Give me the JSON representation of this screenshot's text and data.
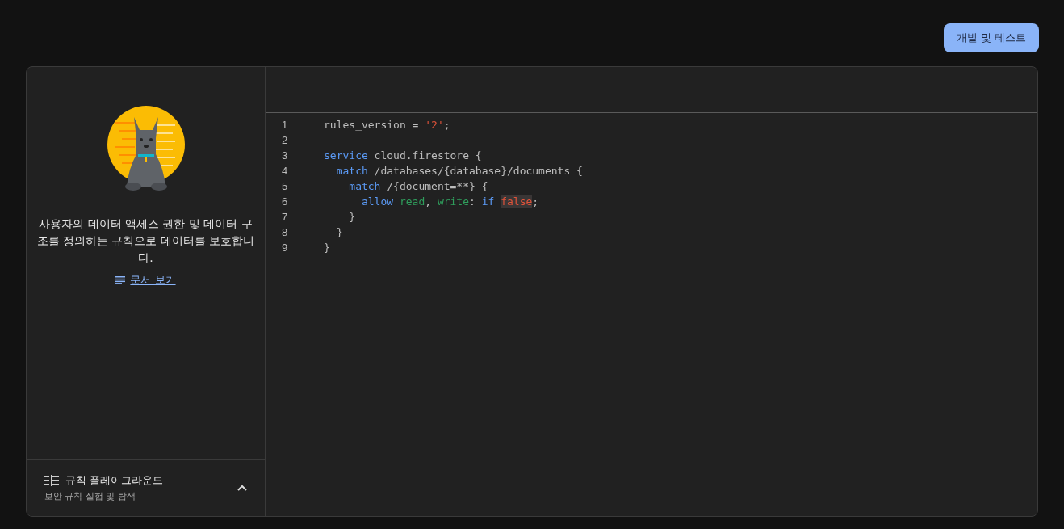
{
  "header": {
    "button": "개발 및 테스트"
  },
  "sidebar": {
    "description": "사용자의 데이터 액세스 권한 및 데이터 구조를 정의하는 규칙으로 데이터를 보호합니다.",
    "docs_link": "문서 보기",
    "playground": {
      "title": "규칙 플레이그라운드",
      "subtitle": "보안 규칙 실험 및 탐색",
      "expanded": false
    }
  },
  "editor": {
    "lines": [
      {
        "number": "1",
        "tokens": [
          {
            "text": "rules_version = ",
            "kind": "plain"
          },
          {
            "text": "'2'",
            "kind": "string"
          },
          {
            "text": ";",
            "kind": "plain"
          }
        ]
      },
      {
        "number": "2"
      },
      {
        "number": "3",
        "tokens": [
          {
            "text": "service",
            "kind": "keyword"
          },
          {
            "text": " cloud.firestore {",
            "kind": "plain"
          }
        ]
      },
      {
        "number": "4",
        "tokens": [
          {
            "text": "  match",
            "kind": "keyword"
          },
          {
            "text": " /databases/{database}/documents {",
            "kind": "plain"
          }
        ]
      },
      {
        "number": "5",
        "tokens": [
          {
            "text": "    match",
            "kind": "keyword"
          },
          {
            "text": " /{document=**} {",
            "kind": "plain"
          }
        ]
      },
      {
        "number": "6",
        "tokens": [
          {
            "text": "      allow",
            "kind": "keyword"
          },
          {
            "text": " read",
            "kind": "method"
          },
          {
            "text": ", ",
            "kind": "plain"
          },
          {
            "text": "write",
            "kind": "method"
          },
          {
            "text": ": ",
            "kind": "plain"
          },
          {
            "text": "if ",
            "kind": "keyword"
          },
          {
            "text": "false",
            "kind": "highlighted"
          },
          {
            "text": ";",
            "kind": "plain"
          }
        ]
      },
      {
        "number": "7",
        "tokens": [
          {
            "text": "    }",
            "kind": "plain"
          }
        ]
      },
      {
        "number": "8",
        "tokens": [
          {
            "text": "  }",
            "kind": "plain"
          }
        ]
      },
      {
        "number": "9",
        "tokens": [
          {
            "text": "}",
            "kind": "plain"
          }
        ]
      }
    ]
  }
}
